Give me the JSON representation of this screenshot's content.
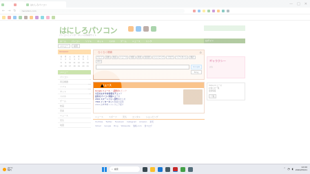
{
  "browser": {
    "active_tab_title": "はにしろパソコン",
    "url": "hanishiro.com",
    "window_controls": [
      "—",
      "□",
      "✕"
    ]
  },
  "site": {
    "logo": "はにしろパソコン",
    "logo_sub": "パソコンとインターネットの情報サイト",
    "nav_items": [
      "ホーム",
      "パソコン",
      "ソフト",
      "ネット",
      "スマホ",
      "ゲーム",
      "ニュース",
      "リンク"
    ],
    "nav_right": "ログイン",
    "selectors": [
      "メニュー",
      "検索"
    ],
    "calendar_header": "Amazon",
    "calendar_days": [
      "日",
      "月",
      "火",
      "水",
      "木",
      "金",
      "土",
      "1",
      "2",
      "3",
      "4",
      "5",
      "6",
      "7",
      "8",
      "9",
      "10",
      "11",
      "12",
      "13",
      "14",
      "15",
      "16",
      "17",
      "18",
      "19",
      "20",
      "21"
    ],
    "left_menu": [
      "メニュー",
      "パソコン",
      "周辺機器",
      "ソフト",
      "ネット",
      "スマホ",
      "ゲーム",
      "動画",
      "音楽",
      "ニュース",
      "天気",
      "地図",
      "辞書",
      "翻訳",
      "ブログ"
    ],
    "search": {
      "title": "らくらく検索",
      "engines": [
        "ウェブ",
        "画像",
        "動画",
        "ニュース",
        "地図",
        "辞書",
        "知恵袋",
        "ショッピング",
        "ブログ",
        "リアルタイム",
        "翻訳",
        "Wiki"
      ],
      "placeholder": "",
      "google_label": "Google",
      "bing_label": "Bing"
    },
    "news": {
      "header": "ニュース",
      "lines": [
        "Google ニュース ・ 話題のトピック",
        "今日のおすすめ情報をチェック",
        "最新のパソコン関連ニュース",
        "2024 スマートフォン新機種まとめ",
        "2024 インターネット関連の話題",
        "2024 おすすめソフトウェア紹介"
      ]
    },
    "links_tabs": [
      "ニュース",
      "スポーツ",
      "天気",
      "エンタメ",
      "ショッピング"
    ],
    "links_rows": [
      [
        "YouTube",
        "Twitter",
        "Facebook",
        "Instagram",
        "Amazon",
        "楽天"
      ],
      [
        "Yahoo!",
        "Google",
        "Bing",
        "Wikipedia",
        "価格.com",
        "食べログ"
      ]
    ],
    "ad": {
      "title": "ギャラクシー",
      "text": "広告"
    },
    "right_box_lines": [
      "Yahoo!ニュース",
      "お知らせ一覧",
      "更新情報"
    ],
    "right_button": "一覧"
  },
  "taskbar": {
    "weather_temp": "21°C",
    "weather_desc": "晴れ",
    "search_placeholder": "検索",
    "time": "12:00",
    "date": "2024/05/01"
  }
}
